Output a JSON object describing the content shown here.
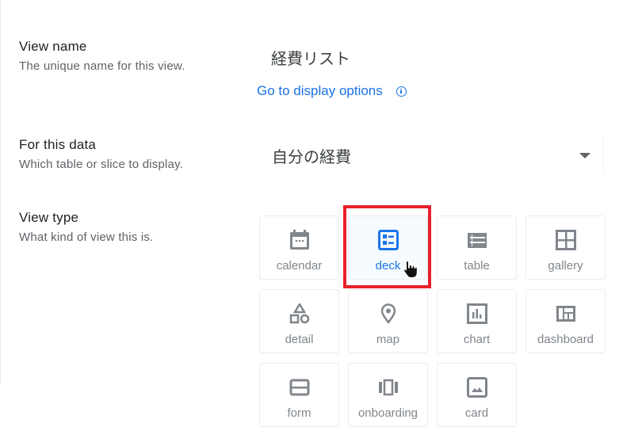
{
  "view_name": {
    "title": "View name",
    "description": "The unique name for this view.",
    "value": "経費リスト",
    "display_options_link": "Go to display options",
    "info_icon": "info-icon"
  },
  "for_this_data": {
    "title": "For this data",
    "description": "Which table or slice to display.",
    "selected": "自分の経費",
    "dropdown_icon": "caret-down-icon"
  },
  "view_type": {
    "title": "View type",
    "description": "What kind of view this is.",
    "selected": "deck",
    "accent_color": "#1a73e8",
    "highlight_color": "#e8202a",
    "options": [
      {
        "label": "calendar",
        "icon": "calendar-icon"
      },
      {
        "label": "deck",
        "icon": "deck-icon"
      },
      {
        "label": "table",
        "icon": "table-icon"
      },
      {
        "label": "gallery",
        "icon": "gallery-icon"
      },
      {
        "label": "detail",
        "icon": "detail-icon"
      },
      {
        "label": "map",
        "icon": "map-pin-icon"
      },
      {
        "label": "chart",
        "icon": "chart-icon"
      },
      {
        "label": "dashboard",
        "icon": "dashboard-icon"
      },
      {
        "label": "form",
        "icon": "form-icon"
      },
      {
        "label": "onboarding",
        "icon": "onboarding-icon"
      },
      {
        "label": "card",
        "icon": "card-icon"
      }
    ]
  }
}
